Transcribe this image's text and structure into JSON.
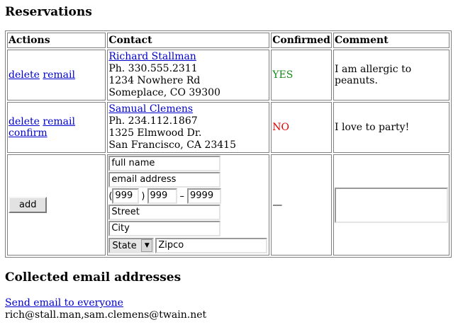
{
  "reservations_heading": "Reservations",
  "collected_heading": "Collected email addresses",
  "table": {
    "headers": {
      "actions": "Actions",
      "contact": "Contact",
      "confirmed": "Confirmed",
      "comment": "Comment"
    },
    "rows": [
      {
        "actions": [
          "delete",
          "remail"
        ],
        "name": "Richard Stallman",
        "phone": "Ph. 330.555.2311",
        "street": "1234 Nowhere Rd",
        "city_line": "Someplace, CO 39300",
        "confirmed": "YES",
        "comment": "I am allergic to peanuts."
      },
      {
        "actions": [
          "delete",
          "remail",
          "confirm"
        ],
        "name": "Samual Clemens",
        "phone": "Ph. 234.112.1867",
        "street": "1325 Elmwood Dr.",
        "city_line": "San Francisco, CA 23415",
        "confirmed": "NO",
        "comment": "I love to party!"
      }
    ]
  },
  "form": {
    "add_label": "add",
    "full_name_placeholder": "full name",
    "email_placeholder": "email address",
    "phone_open": "(",
    "phone_close": ")",
    "phone_dash": "–",
    "area_placeholder": "999",
    "prefix_placeholder": "999",
    "line_placeholder": "9999",
    "street_placeholder": "Street",
    "city_placeholder": "City",
    "state_selected": "State",
    "zip_placeholder": "Zipco",
    "confirmed_placeholder": "—"
  },
  "send_link": "Send email to everyone",
  "emails": "rich@stall.man,sam.clemens@twain.net",
  "colors": {
    "yes": "#1a8a1a",
    "no": "#e00000",
    "link": "#0000cc"
  },
  "icons": {
    "select_arrow": "triangle-down-icon"
  }
}
